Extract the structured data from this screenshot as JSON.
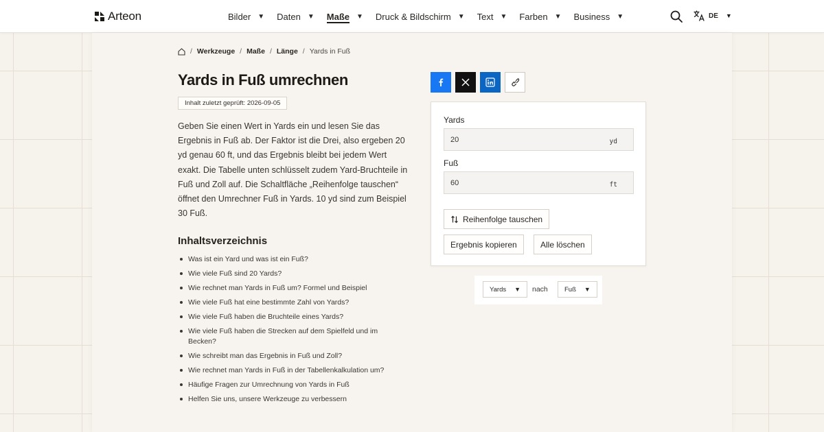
{
  "header": {
    "logo_text": "Arteon",
    "nav": [
      {
        "label": "Bilder",
        "active": false
      },
      {
        "label": "Daten",
        "active": false
      },
      {
        "label": "Maße",
        "active": true
      },
      {
        "label": "Druck & Bildschirm",
        "active": false
      },
      {
        "label": "Text",
        "active": false
      },
      {
        "label": "Farben",
        "active": false
      },
      {
        "label": "Business",
        "active": false
      }
    ],
    "search_icon": "search-icon",
    "language": "DE"
  },
  "breadcrumb": {
    "items": [
      "Werkzeuge",
      "Maße",
      "Länge"
    ],
    "current": "Yards in Fuß",
    "separator": "/"
  },
  "page": {
    "title": "Yards in Fuß umrechnen",
    "review_badge": "Inhalt zuletzt geprüft: 2026-09-05",
    "intro": "Geben Sie einen Wert in Yards ein und lesen Sie das Ergebnis in Fuß ab. Der Faktor ist die Drei, also ergeben 20 yd genau 60 ft, und das Ergebnis bleibt bei jedem Wert exakt. Die Tabelle unten schlüsselt zudem Yard-Bruchteile in Fuß und Zoll auf. Die Schaltfläche „Reihenfolge tauschen“ öffnet den Umrechner Fuß in Yards. 10 yd sind zum Beispiel 30 Fuß."
  },
  "toc": {
    "heading": "Inhaltsverzeichnis",
    "items": [
      "Was ist ein Yard und was ist ein Fuß?",
      "Wie viele Fuß sind 20 Yards?",
      "Wie rechnet man Yards in Fuß um? Formel und Beispiel",
      "Wie viele Fuß hat eine bestimmte Zahl von Yards?",
      "Wie viele Fuß haben die Bruchteile eines Yards?",
      "Wie viele Fuß haben die Strecken auf dem Spielfeld und im Becken?",
      "Wie schreibt man das Ergebnis in Fuß und Zoll?",
      "Wie rechnet man Yards in Fuß in der Tabellenkalkulation um?",
      "Häufige Fragen zur Umrechnung von Yards in Fuß",
      "Helfen Sie uns, unsere Werkzeuge zu verbessern"
    ]
  },
  "share": {
    "icons": [
      "facebook-icon",
      "x-icon",
      "linkedin-icon",
      "link-icon"
    ],
    "colors": {
      "facebook": "#1877f2",
      "x": "#111111",
      "linkedin": "#0a66c2"
    }
  },
  "converter": {
    "from_label": "Yards",
    "from_value": "20",
    "from_unit": "yd",
    "to_label": "Fuß",
    "to_value": "60",
    "to_unit": "ft",
    "swap_label": "Reihenfolge tauschen",
    "copy_label": "Ergebnis kopieren",
    "clear_label": "Alle löschen"
  },
  "direction": {
    "from": "Yards",
    "connector": "nach",
    "to": "Fuß"
  }
}
